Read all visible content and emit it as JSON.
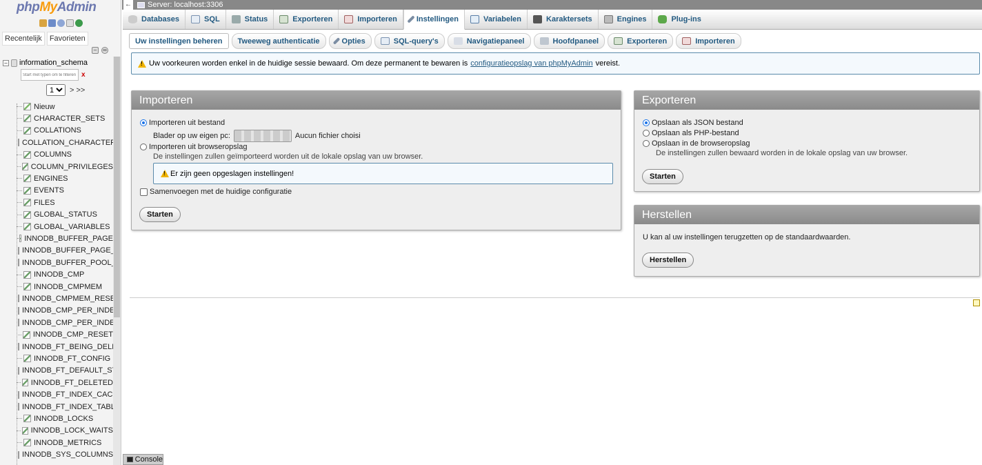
{
  "logo": {
    "php": "php",
    "my": "My",
    "admin": "Admin"
  },
  "nav": {
    "tabs": [
      "Recentelijk",
      "Favorieten"
    ],
    "database": "information_schema",
    "filter_placeholder": "Start met typen om te filteren",
    "filter_clear": "x",
    "page_value": "1",
    "page_next": "> >>",
    "new_label": "Nieuw",
    "tables": [
      "CHARACTER_SETS",
      "COLLATIONS",
      "COLLATION_CHARACTER_SET_APPLICABILITY",
      "COLUMNS",
      "COLUMN_PRIVILEGES",
      "ENGINES",
      "EVENTS",
      "FILES",
      "GLOBAL_STATUS",
      "GLOBAL_VARIABLES",
      "INNODB_BUFFER_PAGE",
      "INNODB_BUFFER_PAGE_LRU",
      "INNODB_BUFFER_POOL_STATS",
      "INNODB_CMP",
      "INNODB_CMPMEM",
      "INNODB_CMPMEM_RESET",
      "INNODB_CMP_PER_INDEX",
      "INNODB_CMP_PER_INDEX_RESET",
      "INNODB_CMP_RESET",
      "INNODB_FT_BEING_DELETED",
      "INNODB_FT_CONFIG",
      "INNODB_FT_DEFAULT_STOPWORD",
      "INNODB_FT_DELETED",
      "INNODB_FT_INDEX_CACHE",
      "INNODB_FT_INDEX_TABLE",
      "INNODB_LOCKS",
      "INNODB_LOCK_WAITS",
      "INNODB_METRICS",
      "INNODB_SYS_COLUMNS"
    ]
  },
  "topbar": {
    "server": "Server: localhost:3306"
  },
  "main_tabs": [
    "Databases",
    "SQL",
    "Status",
    "Exporteren",
    "Importeren",
    "Instellingen",
    "Variabelen",
    "Karaktersets",
    "Engines",
    "Plug-ins"
  ],
  "sub_tabs": [
    "Uw instellingen beheren",
    "Tweeweg authenticatie",
    "Opties",
    "SQL-query's",
    "Navigatiepaneel",
    "Hoofdpaneel",
    "Exporteren",
    "Importeren"
  ],
  "notice": {
    "text": "Uw voorkeuren worden enkel in de huidige sessie bewaard. Om deze permanent te bewaren is",
    "link": "configuratieopslag van phpMyAdmin",
    "suffix": "vereist."
  },
  "import_panel": {
    "title": "Importeren",
    "opt_file": "Importeren uit bestand",
    "browse_label": "Blader op uw eigen pc:",
    "no_file": "Aucun fichier choisi",
    "opt_browser": "Importeren uit browseropslag",
    "browser_hint": "De instellingen zullen geïmporteerd worden uit de lokale opslag van uw browser.",
    "no_saved": "Er zijn geen opgeslagen instellingen!",
    "merge": "Samenvoegen met de huidige configuratie",
    "submit": "Starten"
  },
  "export_panel": {
    "title": "Exporteren",
    "opt_json": "Opslaan als JSON bestand",
    "opt_php": "Opslaan als PHP-bestand",
    "opt_browser": "Opslaan in de browseropslag",
    "browser_hint": "De instellingen zullen bewaard worden in de lokale opslag van uw browser.",
    "submit": "Starten"
  },
  "reset_panel": {
    "title": "Herstellen",
    "text": "U kan al uw instellingen terugzetten op de standaardwaarden.",
    "submit": "Herstellen"
  },
  "console": {
    "label": "Console"
  }
}
